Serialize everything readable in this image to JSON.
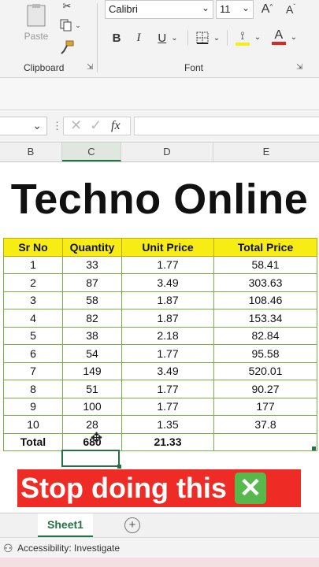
{
  "ribbon": {
    "paste_label": "Paste",
    "clipboard_label": "Clipboard",
    "font_label": "Font",
    "font_name": "Calibri",
    "font_size": "11",
    "bold": "B",
    "italic": "I",
    "underline": "U",
    "grow_font": "A",
    "shrink_font": "A",
    "font_color": "A"
  },
  "formula_bar": {
    "fx": "fx"
  },
  "columns": [
    "B",
    "C",
    "D",
    "E"
  ],
  "title": "Techno Online",
  "table": {
    "headers": [
      "Sr No",
      "Quantity",
      "Unit Price",
      "Total Price"
    ],
    "rows": [
      [
        "1",
        "33",
        "1.77",
        "58.41"
      ],
      [
        "2",
        "87",
        "3.49",
        "303.63"
      ],
      [
        "3",
        "58",
        "1.87",
        "108.46"
      ],
      [
        "4",
        "82",
        "1.87",
        "153.34"
      ],
      [
        "5",
        "38",
        "2.18",
        "82.84"
      ],
      [
        "6",
        "54",
        "1.77",
        "95.58"
      ],
      [
        "7",
        "149",
        "3.49",
        "520.01"
      ],
      [
        "8",
        "51",
        "1.77",
        "90.27"
      ],
      [
        "9",
        "100",
        "1.77",
        "177"
      ],
      [
        "10",
        "28",
        "1.35",
        "37.8"
      ]
    ],
    "total": [
      "Total",
      "680",
      "21.33",
      ""
    ]
  },
  "banner": {
    "text": "Stop doing this",
    "icon": "cross-mark-icon"
  },
  "sheet": {
    "tab": "Sheet1"
  },
  "status": {
    "accessibility": "Accessibility: Investigate"
  },
  "colors": {
    "header_fill": "#f7ec13",
    "grid_green": "#76b046",
    "banner_red": "#ee2b24",
    "excel_green": "#217346"
  }
}
